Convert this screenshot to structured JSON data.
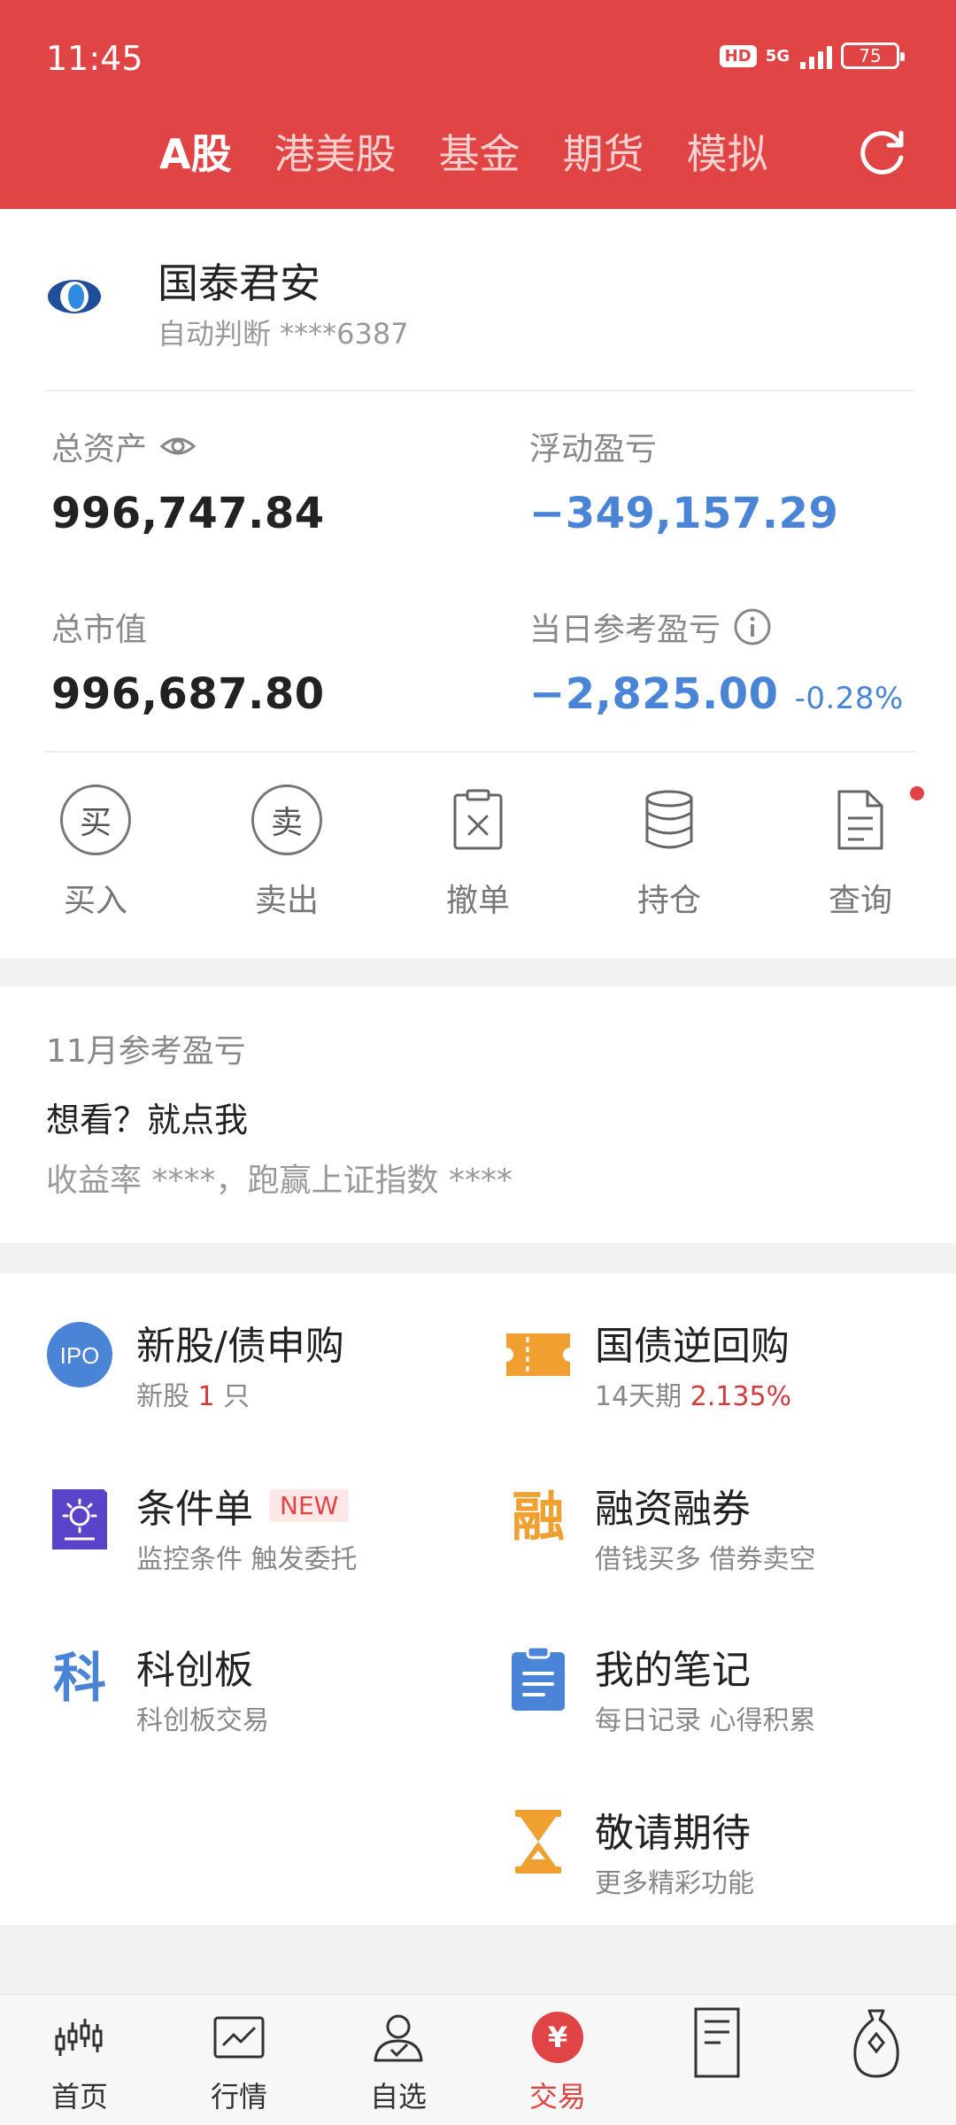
{
  "status_bar": {
    "time": "11:45",
    "hd": "HD",
    "network": "5G",
    "battery": "75"
  },
  "header": {
    "tabs": [
      {
        "label": "A股",
        "active": true
      },
      {
        "label": "港美股",
        "active": false
      },
      {
        "label": "基金",
        "active": false
      },
      {
        "label": "期货",
        "active": false
      },
      {
        "label": "模拟",
        "active": false
      }
    ],
    "refresh_icon": "refresh-icon"
  },
  "account": {
    "broker": "国泰君安",
    "sub": "自动判断 ****6387",
    "total_assets_label": "总资产",
    "total_assets": "996,747.84",
    "floating_pl_label": "浮动盈亏",
    "floating_pl": "−349,157.29",
    "market_value_label": "总市值",
    "market_value": "996,687.80",
    "daily_pl_label": "当日参考盈亏",
    "daily_pl": "−2,825.00",
    "daily_pl_pct": "-0.28%",
    "accent_color": "#4a84d6"
  },
  "actions": [
    {
      "label": "买入",
      "glyph": "买",
      "icon": "buy-icon"
    },
    {
      "label": "卖出",
      "glyph": "卖",
      "icon": "sell-icon"
    },
    {
      "label": "撤单",
      "icon": "cancel-order-icon"
    },
    {
      "label": "持仓",
      "icon": "holdings-icon"
    },
    {
      "label": "查询",
      "icon": "query-icon"
    }
  ],
  "monthly": {
    "title": "11月参考盈亏",
    "cta": "想看？就点我",
    "desc": "收益率 ****，跑赢上证指数 ****"
  },
  "services": [
    {
      "title": "新股/债申购",
      "sub_prefix": "新股 ",
      "sub_highlight": "1",
      "sub_suffix": " 只",
      "icon": "ipo-icon",
      "icon_text": "IPO"
    },
    {
      "title": "国债逆回购",
      "sub_prefix": "14天期 ",
      "sub_highlight": "2.135%",
      "sub_suffix": "",
      "icon": "ticket-icon"
    },
    {
      "title": "条件单",
      "badge": "NEW",
      "sub": "监控条件 触发委托",
      "icon": "conditional-order-icon"
    },
    {
      "title": "融资融券",
      "sub": "借钱买多 借券卖空",
      "icon": "margin-icon",
      "icon_text": "融"
    },
    {
      "title": "科创板",
      "sub": "科创板交易",
      "icon": "star-market-icon",
      "icon_text": "科"
    },
    {
      "title": "我的笔记",
      "sub": "每日记录 心得积累",
      "icon": "notes-icon"
    },
    {
      "title": "敬请期待",
      "sub": "更多精彩功能",
      "icon": "hourglass-icon"
    }
  ],
  "bottom_nav": [
    {
      "label": "首页",
      "icon": "home-chart-icon",
      "active": false
    },
    {
      "label": "行情",
      "icon": "market-icon",
      "active": false
    },
    {
      "label": "自选",
      "icon": "watchlist-icon",
      "active": false
    },
    {
      "label": "交易",
      "icon": "trade-icon",
      "active": true,
      "glyph": "¥"
    },
    {
      "label": "",
      "icon": "news-icon",
      "active": false
    },
    {
      "label": "",
      "icon": "wealth-icon",
      "active": false
    }
  ],
  "colors": {
    "brand_red": "#e04444",
    "negative_blue": "#4a84d6",
    "orange": "#f0a030"
  }
}
